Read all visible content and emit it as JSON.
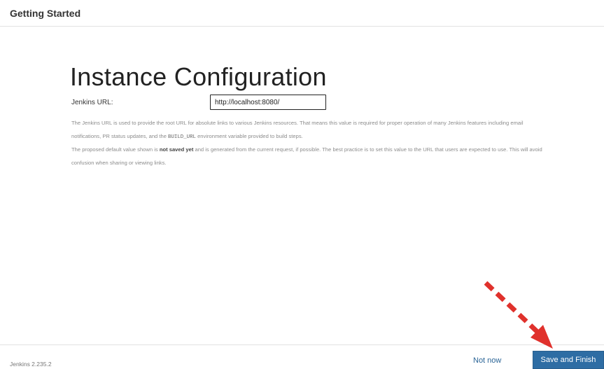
{
  "header": {
    "title": "Getting Started"
  },
  "main": {
    "title": "Instance Configuration",
    "url_label": "Jenkins URL:",
    "url_value": "http://localhost:8080/",
    "help_1_part_1": "The Jenkins URL is used to provide the root URL for absolute links to various Jenkins resources. That means this value is required for proper operation of many Jenkins features including email notifications, PR status updates, and the ",
    "help_1_code": "BUILD_URL",
    "help_1_part_2": " environment variable provided to build steps.",
    "help_2_part_1": "The proposed default value shown is ",
    "help_2_bold": "not saved yet",
    "help_2_part_2": " and is generated from the current request, if possible. The best practice is to set this value to the URL that users are expected to use. This will avoid confusion when sharing or viewing links."
  },
  "footer": {
    "version": "Jenkins 2.235.2",
    "not_now_label": "Not now",
    "save_label": "Save and Finish"
  },
  "colors": {
    "primary_button": "#2e6da4",
    "link": "#2a6496",
    "annotation_arrow": "#e0312c"
  },
  "icons": {
    "annotation": "red-dashed-arrow-icon"
  }
}
